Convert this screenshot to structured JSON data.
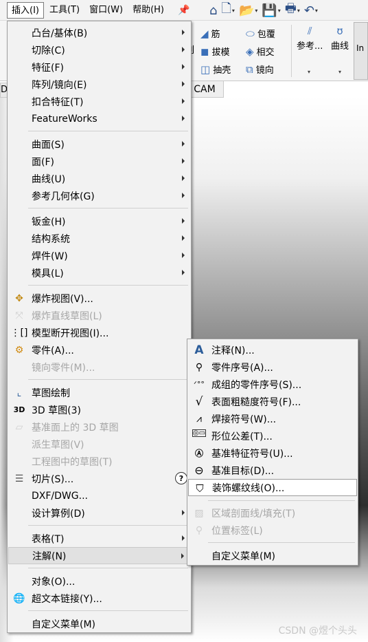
{
  "menubar": {
    "items": [
      "插入(I)",
      "工具(T)",
      "窗口(W)",
      "帮助(H)"
    ]
  },
  "toolbar_icons": [
    "home-icon",
    "new-doc-icon",
    "open-folder-icon",
    "save-icon",
    "print-icon",
    "undo-icon"
  ],
  "ribbon": {
    "items": [
      "筋",
      "包覆",
      "拔模",
      "相交",
      "抽壳",
      "镜向",
      "参考...",
      "曲线"
    ],
    "cam_tab": "CAM",
    "d_tab": "D",
    "left_fragment": "列",
    "right_tab": "In"
  },
  "main_menu": [
    {
      "label": "凸台/基体(B)",
      "submenu": true
    },
    {
      "label": "切除(C)",
      "submenu": true
    },
    {
      "label": "特征(F)",
      "submenu": true
    },
    {
      "label": "阵列/镜向(E)",
      "submenu": true
    },
    {
      "label": "扣合特征(T)",
      "submenu": true
    },
    {
      "label": "FeatureWorks",
      "submenu": true
    },
    {
      "label": "曲面(S)",
      "submenu": true
    },
    {
      "label": "面(F)",
      "submenu": true
    },
    {
      "label": "曲线(U)",
      "submenu": true
    },
    {
      "label": "参考几何体(G)",
      "submenu": true
    },
    {
      "label": "钣金(H)",
      "submenu": true
    },
    {
      "label": "结构系统",
      "submenu": true
    },
    {
      "label": "焊件(W)",
      "submenu": true
    },
    {
      "label": "模具(L)",
      "submenu": true
    },
    {
      "label": "爆炸视图(V)..."
    },
    {
      "label": "爆炸直线草图(L)"
    },
    {
      "label": "模型断开视图(I)..."
    },
    {
      "label": "零件(A)..."
    },
    {
      "label": "镜向零件(M)..."
    },
    {
      "label": "草图绘制"
    },
    {
      "label": "3D 草图(3)"
    },
    {
      "label": "基准面上的 3D 草图"
    },
    {
      "label": "派生草图(V)"
    },
    {
      "label": "工程图中的草图(T)"
    },
    {
      "label": "切片(S)..."
    },
    {
      "label": "DXF/DWG..."
    },
    {
      "label": "设计算例(D)",
      "submenu": true
    },
    {
      "label": "表格(T)",
      "submenu": true
    },
    {
      "label": "注解(N)",
      "submenu": true
    },
    {
      "label": "对象(O)..."
    },
    {
      "label": "超文本链接(Y)..."
    },
    {
      "label": "自定义菜单(M)"
    }
  ],
  "sub_menu": [
    {
      "label": "注释(N)..."
    },
    {
      "label": "零件序号(A)..."
    },
    {
      "label": "成组的零件序号(S)..."
    },
    {
      "label": "表面粗糙度符号(F)..."
    },
    {
      "label": "焊接符号(W)..."
    },
    {
      "label": "形位公差(T)..."
    },
    {
      "label": "基准特征符号(U)..."
    },
    {
      "label": "基准目标(D)..."
    },
    {
      "label": "装饰螺纹线(O)..."
    },
    {
      "label": "区域剖面线/填充(T)"
    },
    {
      "label": "位置标签(L)"
    },
    {
      "label": "自定义菜单(M)"
    }
  ],
  "watermark": "CSDN @煜个头头"
}
